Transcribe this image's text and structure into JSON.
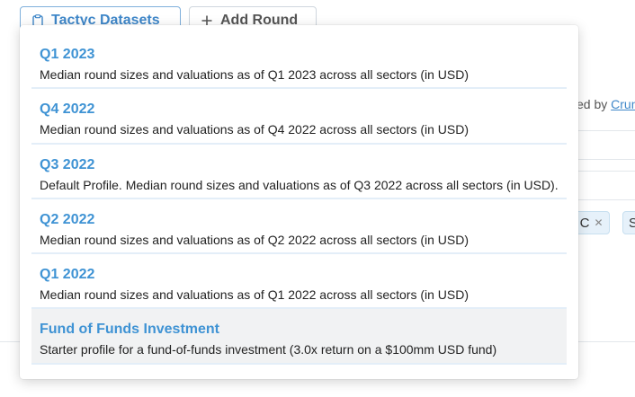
{
  "toolbar": {
    "datasets_label": "Tactyc Datasets",
    "add_round_label": "Add Round",
    "add_round_icon": "plus-icon",
    "datasets_icon": "clipboard-icon"
  },
  "background": {
    "powered_prefix": "ed by",
    "powered_link": "Crun",
    "tags": [
      "s C",
      "S"
    ]
  },
  "dropdown": {
    "items": [
      {
        "title": "Q1 2023",
        "description": "Median round sizes and valuations as of Q1 2023 across all sectors (in USD)"
      },
      {
        "title": "Q4 2022",
        "description": "Median round sizes and valuations as of Q4 2022 across all sectors (in USD)"
      },
      {
        "title": "Q3 2022",
        "description": "Default Profile. Median round sizes and valuations as of Q3 2022 across all sectors (in USD)."
      },
      {
        "title": "Q2 2022",
        "description": "Median round sizes and valuations as of Q2 2022 across all sectors (in USD)"
      },
      {
        "title": "Q1 2022",
        "description": "Median round sizes and valuations as of Q1 2022 across all sectors (in USD)"
      },
      {
        "title": "Fund of Funds Investment",
        "description": "Starter profile for a fund-of-funds investment (3.0x return on a $100mm USD fund)"
      }
    ],
    "highlighted_index": 5
  },
  "colors": {
    "accent": "#3f93d4",
    "highlight_bg": "#f1f2f3",
    "tag_bg": "#e6f1fa"
  }
}
